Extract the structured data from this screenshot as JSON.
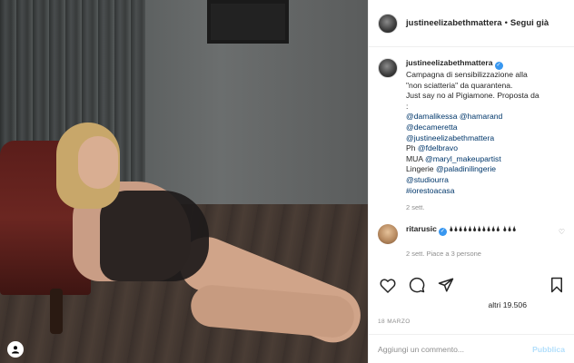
{
  "post": {
    "owner": "justineelizabethmattera",
    "follow_sep": "•",
    "follow_label": "Segui già",
    "caption": {
      "owner": "justineelizabethmattera",
      "lines": [
        "Campagna di sensibilizzazione alla",
        "\"non sciatteria\" da quarantena.",
        "Just say no al Pigiamone. Proposta da",
        ":"
      ],
      "mentions": [
        "@damalikessa @hamarand",
        "@decameretta",
        "@justineelizabethmattera"
      ],
      "ph_label": "Ph",
      "ph_mention": "@fdelbravo",
      "mua_label": "MUA",
      "mua_mention": "@maryl_makeupartist",
      "lingerie_label": "Lingerie",
      "lingerie_mention": "@paladinilingerie",
      "studio_mention": "@studiourra",
      "hashtag": "#iorestoacasa",
      "time": "2 sett."
    },
    "comment": {
      "owner": "ritarusic",
      "text": "🌢🌢🌢🌢🌢🌢🌢🌢🌢🌢🌢 🌢🌢🌢",
      "meta": "2 sett.   Piace a 3 persone"
    },
    "likes": "altri 19.506",
    "date": "18 MARZO",
    "add_comment_placeholder": "Aggiungi un commento...",
    "publish_label": "Pubblica"
  },
  "icons": {
    "heart": "heart-icon",
    "comment": "comment-icon",
    "share": "share-icon",
    "save": "bookmark-icon",
    "user": "user-icon"
  },
  "colors": {
    "link": "#00376b",
    "verified": "#3897f0",
    "muted": "#8e8e8e",
    "publish_disabled": "#b2dffc"
  }
}
